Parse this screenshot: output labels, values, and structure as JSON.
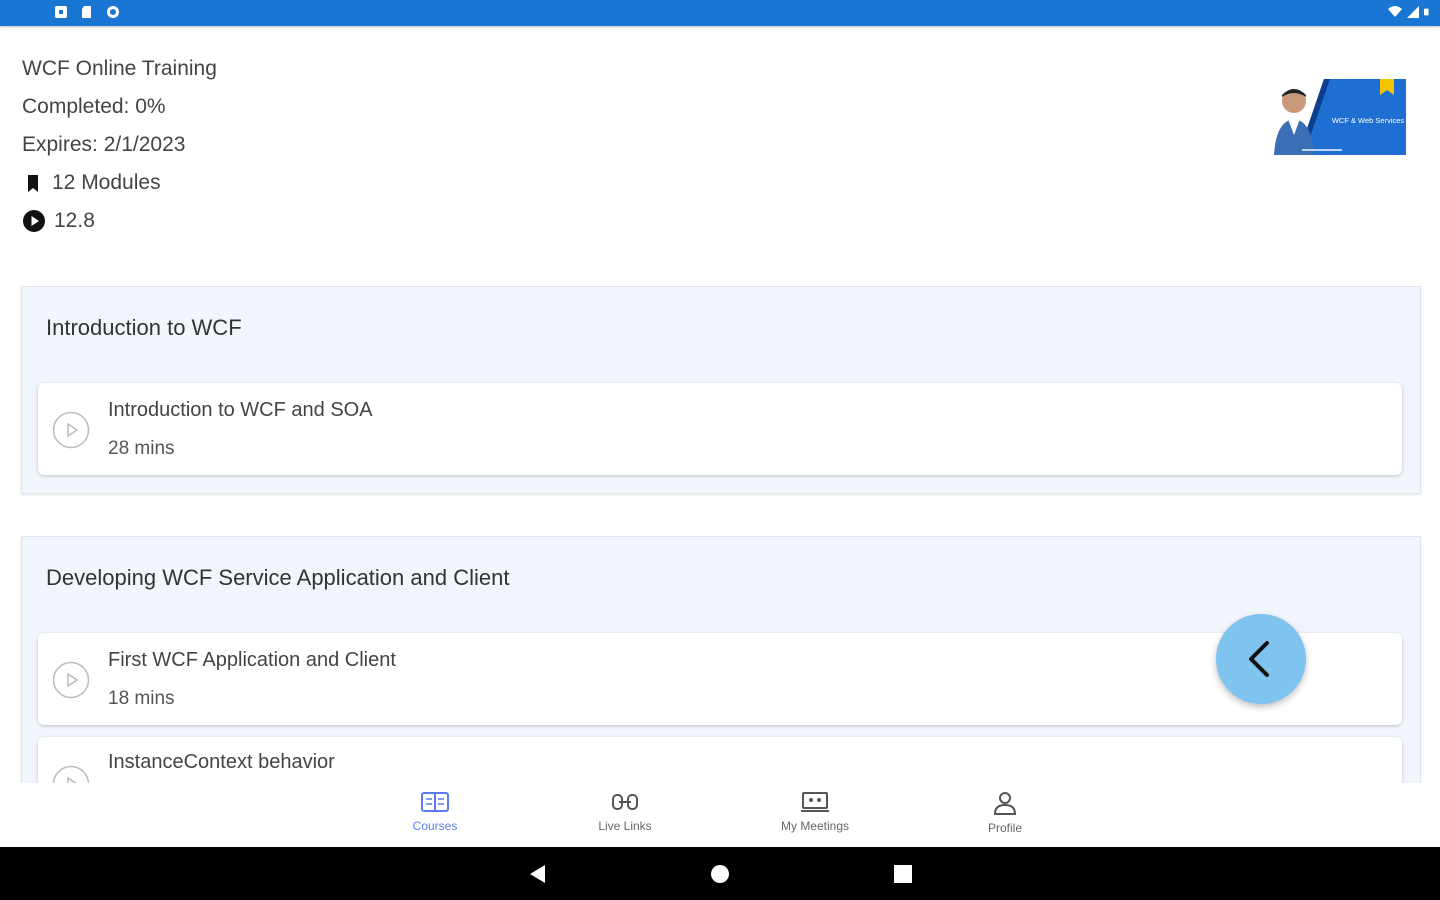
{
  "course": {
    "title": "WCF Online Training",
    "completed": "Completed: 0%",
    "expires": "Expires: 2/1/2023",
    "modules": "12 Modules",
    "hours": "12.8",
    "thumbnail_text": "WCF & Web Services"
  },
  "sections": [
    {
      "title": "Introduction to WCF",
      "lessons": [
        {
          "title": "Introduction to WCF and SOA",
          "duration": "28 mins"
        }
      ]
    },
    {
      "title": "Developing WCF Service Application and Client",
      "lessons": [
        {
          "title": "First WCF Application and Client",
          "duration": "18 mins"
        },
        {
          "title": "InstanceContext behavior",
          "duration": ""
        }
      ]
    }
  ],
  "bottom_nav": {
    "items": [
      {
        "label": "Courses",
        "icon": "courses-icon"
      },
      {
        "label": "Live Links",
        "icon": "live-links-icon"
      },
      {
        "label": "My Meetings",
        "icon": "meetings-icon"
      },
      {
        "label": "Profile",
        "icon": "profile-icon"
      }
    ]
  },
  "colors": {
    "status_bar": "#1976d2",
    "section_bg": "#f1f6fc",
    "fab": "#7fc3ef",
    "nav_active": "#5b7cf0"
  }
}
